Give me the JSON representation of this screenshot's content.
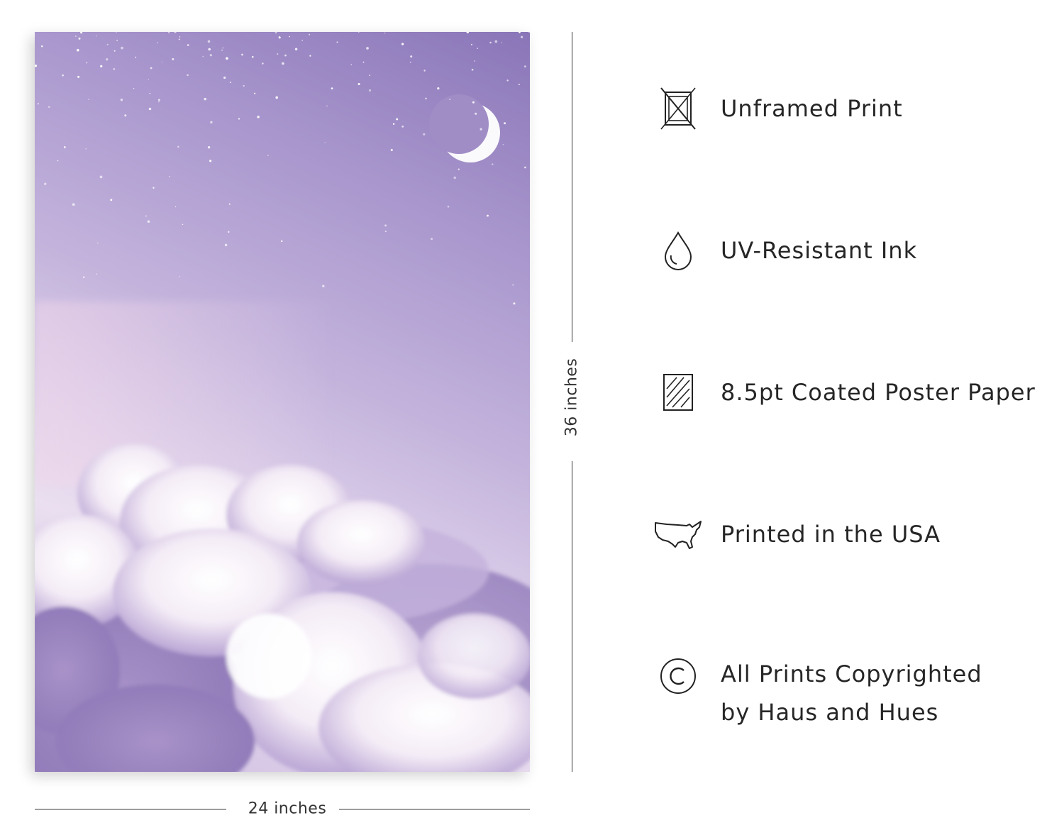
{
  "poster": {
    "width_label": "24 inches",
    "height_label": "36 inches",
    "sky_colors": [
      "#8a76b8",
      "#c3b3dc",
      "#eadff0"
    ]
  },
  "features": [
    {
      "icon": "unframed-frame-icon",
      "label": "Unframed Print"
    },
    {
      "icon": "ink-drop-icon",
      "label": "UV-Resistant Ink"
    },
    {
      "icon": "coated-paper-icon",
      "label": "8.5pt Coated Poster Paper"
    },
    {
      "icon": "usa-map-icon",
      "label": "Printed in the USA"
    },
    {
      "icon": "copyright-icon",
      "label_line1": "All Prints Copyrighted",
      "label_line2": "by Haus and Hues"
    }
  ]
}
